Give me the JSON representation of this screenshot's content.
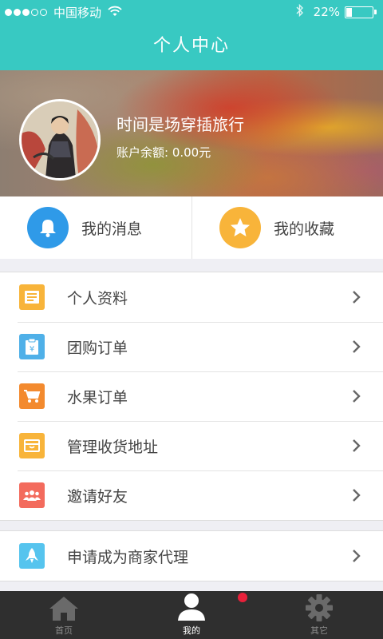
{
  "status_bar": {
    "carrier": "中国移动",
    "battery": "22%",
    "battery_level": 0.22,
    "signal_icon": "signal-dots-icon",
    "wifi_icon": "wifi-icon",
    "bluetooth_icon": "bluetooth-icon"
  },
  "header": {
    "title": "个人中心"
  },
  "profile": {
    "name": "时间是场穿插旅行",
    "balance_label": "账户余额: ",
    "balance_value": "0.00元"
  },
  "quick_actions": [
    {
      "label": "我的消息",
      "icon": "bell-icon",
      "color": "#2f9ae8"
    },
    {
      "label": "我的收藏",
      "icon": "star-icon",
      "color": "#f8b43a"
    }
  ],
  "menu": [
    {
      "label": "个人资料",
      "icon": "profile-card-icon",
      "color": "#f8b43a"
    },
    {
      "label": "团购订单",
      "icon": "group-order-icon",
      "color": "#4fb0e8"
    },
    {
      "label": "水果订单",
      "icon": "cart-icon",
      "color": "#f38a2e"
    },
    {
      "label": "管理收货地址",
      "icon": "address-box-icon",
      "color": "#f8b43a"
    },
    {
      "label": "邀请好友",
      "icon": "friends-icon",
      "color": "#f36b5d"
    }
  ],
  "menu2": [
    {
      "label": "申请成为商家代理",
      "icon": "rocket-icon",
      "color": "#56c4ee"
    }
  ],
  "tabbar": [
    {
      "label": "首页",
      "icon": "home-icon",
      "active": false
    },
    {
      "label": "我的",
      "icon": "user-icon",
      "active": true,
      "badge": true
    },
    {
      "label": "其它",
      "icon": "gear-icon",
      "active": false
    }
  ],
  "colors": {
    "accent": "#38c9c2",
    "tabbar": "#2f2f2f",
    "badge": "#e8203a"
  }
}
